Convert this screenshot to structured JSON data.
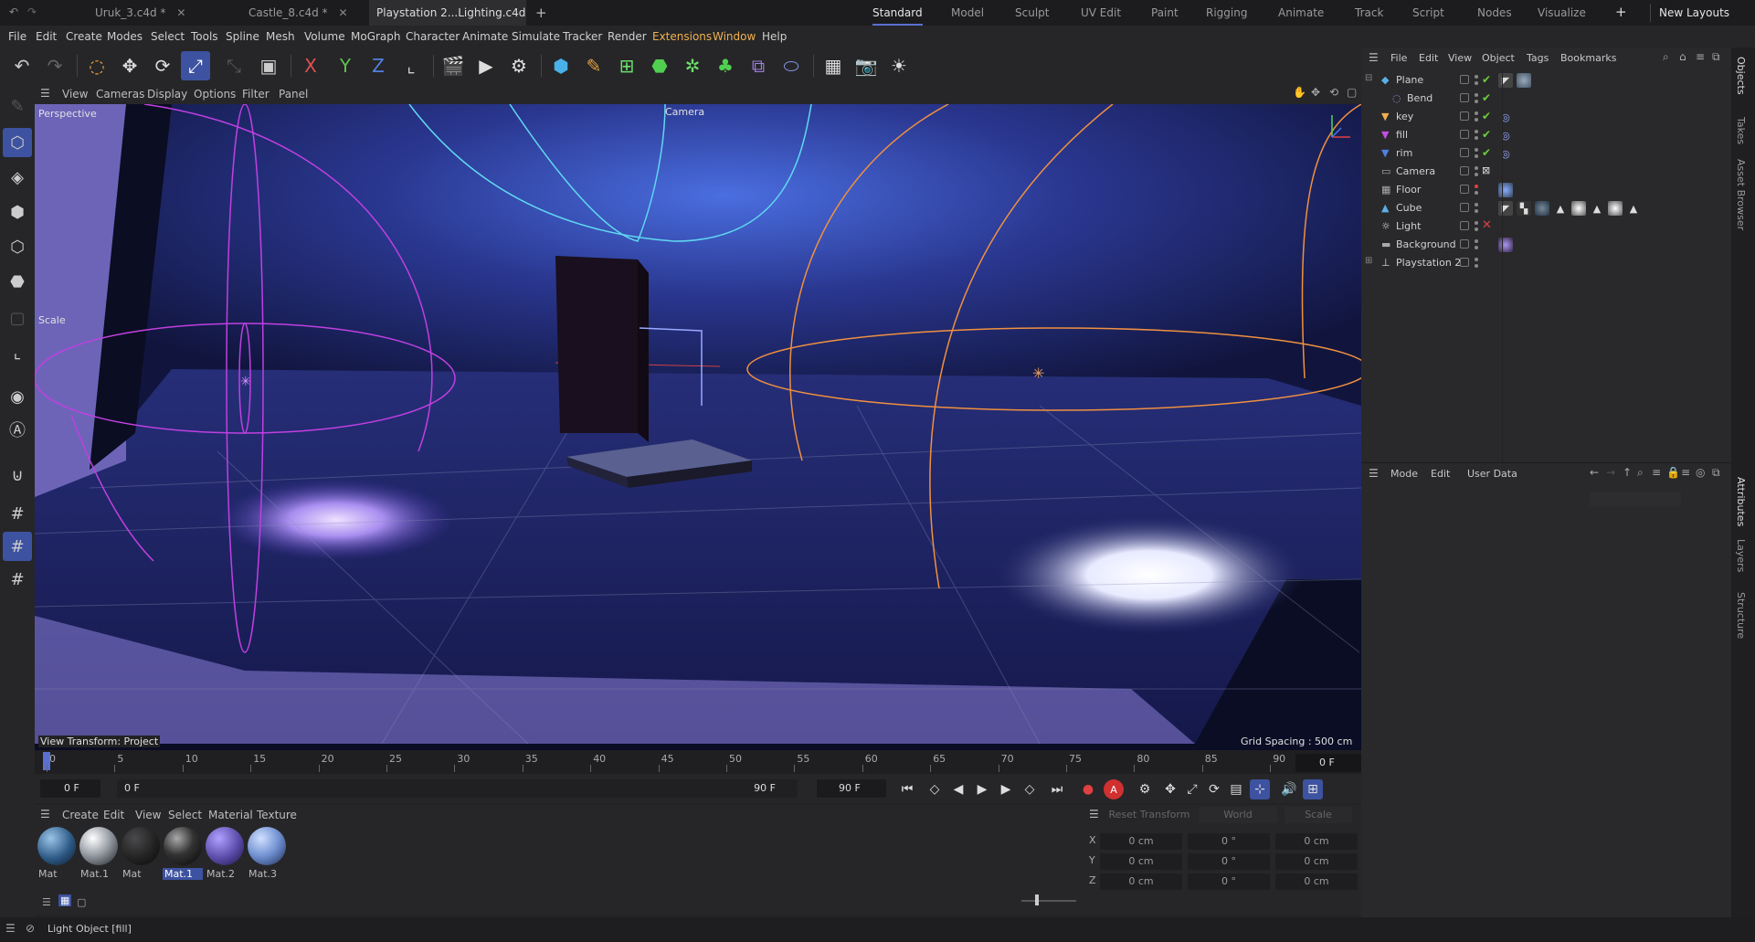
{
  "tabs": [
    {
      "label": "Uruk_3.c4d *",
      "active": false
    },
    {
      "label": "Castle_8.c4d *",
      "active": false
    },
    {
      "label": "Playstation 2...Lighting.c4d *",
      "active": true
    }
  ],
  "layouts": [
    "Standard",
    "Model",
    "Sculpt",
    "UV Edit",
    "Paint",
    "Rigging",
    "Animate",
    "Track",
    "Script",
    "Nodes",
    "Visualize"
  ],
  "new_layouts": "New Layouts",
  "menu": [
    "File",
    "Edit",
    "Create",
    "Modes",
    "Select",
    "Tools",
    "Spline",
    "Mesh",
    "Volume",
    "MoGraph",
    "Character",
    "Animate",
    "Simulate",
    "Tracker",
    "Render",
    "Extensions",
    "Window",
    "Help"
  ],
  "viewport": {
    "menu": [
      "View",
      "Cameras",
      "Display",
      "Options",
      "Filter",
      "Panel"
    ],
    "view_name": "Perspective",
    "camera_label": "Camera",
    "scale_label": "Scale",
    "view_transform": "View Transform: Project",
    "grid_spacing": "Grid Spacing : 500 cm"
  },
  "timeline": {
    "ticks": [
      "0",
      "5",
      "10",
      "15",
      "20",
      "25",
      "30",
      "35",
      "40",
      "45",
      "50",
      "55",
      "60",
      "65",
      "70",
      "75",
      "80",
      "85",
      "90"
    ],
    "current_frame": "0 F",
    "start": "0 F",
    "range_start": "0 F",
    "range_end": "90 F",
    "end": "90 F"
  },
  "material_menu": [
    "Create",
    "Edit",
    "View",
    "Select",
    "Material",
    "Texture"
  ],
  "materials": [
    {
      "name": "Mat",
      "color": "#3a6e9a",
      "selected": false
    },
    {
      "name": "Mat.1",
      "color": "#9aa0a8",
      "selected": false
    },
    {
      "name": "Mat",
      "color": "#2a2a2c",
      "selected": false
    },
    {
      "name": "Mat.1",
      "color": "#3a3a3c",
      "selected": true
    },
    {
      "name": "Mat.2",
      "color": "#5a4aa8",
      "selected": false
    },
    {
      "name": "Mat.3",
      "color": "#6f8fd0",
      "selected": false
    }
  ],
  "coords": {
    "reset": "Reset Transform",
    "world": "World",
    "scale": "Scale",
    "rows": [
      {
        "axis": "X",
        "p": "0 cm",
        "r": "0 °",
        "s": "0 cm"
      },
      {
        "axis": "Y",
        "p": "0 cm",
        "r": "0 °",
        "s": "0 cm"
      },
      {
        "axis": "Z",
        "p": "0 cm",
        "r": "0 °",
        "s": "0 cm"
      }
    ]
  },
  "status": "Light Object [fill]",
  "object_menu": [
    "File",
    "Edit",
    "View",
    "Object",
    "Tags",
    "Bookmarks"
  ],
  "objects": [
    {
      "name": "Plane",
      "icon": "plane-icon",
      "indent": 0
    },
    {
      "name": "Bend",
      "icon": "bend-deformer-icon",
      "indent": 1
    },
    {
      "name": "key",
      "icon": "light-icon",
      "indent": 0
    },
    {
      "name": "fill",
      "icon": "light-icon",
      "indent": 0
    },
    {
      "name": "rim",
      "icon": "light-icon",
      "indent": 0
    },
    {
      "name": "Camera",
      "icon": "camera-icon",
      "indent": 0
    },
    {
      "name": "Floor",
      "icon": "floor-icon",
      "indent": 0
    },
    {
      "name": "Cube",
      "icon": "cube-icon",
      "indent": 0
    },
    {
      "name": "Light",
      "icon": "light-icon",
      "indent": 0
    },
    {
      "name": "Background",
      "icon": "background-icon",
      "indent": 0
    },
    {
      "name": "Playstation 2",
      "icon": "null-icon",
      "indent": 0
    }
  ],
  "attr_menu": [
    "Mode",
    "Edit",
    "User Data"
  ],
  "side_tabs": [
    "Objects",
    "Takes",
    "Asset Browser",
    "Attributes",
    "Layers",
    "Structure"
  ],
  "colors": {
    "accent": "#3d52a0",
    "check": "#6ccf3c",
    "cross": "#e04040"
  }
}
